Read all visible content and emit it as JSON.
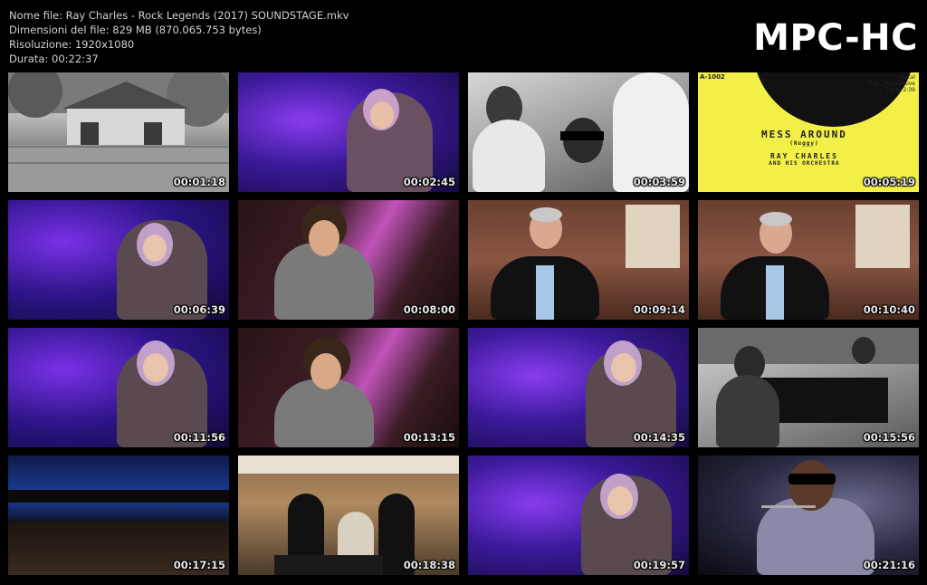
{
  "header": {
    "line1": "Nome file: Ray Charles - Rock Legends (2017) SOUNDSTAGE.mkv",
    "line2": "Dimensioni del file: 829 MB (870.065.753 bytes)",
    "line3": "Risoluzione: 1920x1080",
    "line4": "Durata: 00:22:37"
  },
  "logo": "MPC-HC",
  "record": {
    "catalog": "A-1002",
    "right_lines": [
      "Vocal",
      "Pub., Progressive",
      "Time: 2:39"
    ],
    "title": "MESS AROUND",
    "composer": "(Nuggy)",
    "artist": "RAY CHARLES",
    "artist_sub": "AND HIS ORCHESTRA"
  },
  "thumbs": [
    {
      "time": "00:01:18"
    },
    {
      "time": "00:02:45"
    },
    {
      "time": "00:03:59"
    },
    {
      "time": "00:05:19"
    },
    {
      "time": "00:06:39"
    },
    {
      "time": "00:08:00"
    },
    {
      "time": "00:09:14"
    },
    {
      "time": "00:10:40"
    },
    {
      "time": "00:11:56"
    },
    {
      "time": "00:13:15"
    },
    {
      "time": "00:14:35"
    },
    {
      "time": "00:15:56"
    },
    {
      "time": "00:17:15"
    },
    {
      "time": "00:18:38"
    },
    {
      "time": "00:19:57"
    },
    {
      "time": "00:21:16"
    }
  ]
}
